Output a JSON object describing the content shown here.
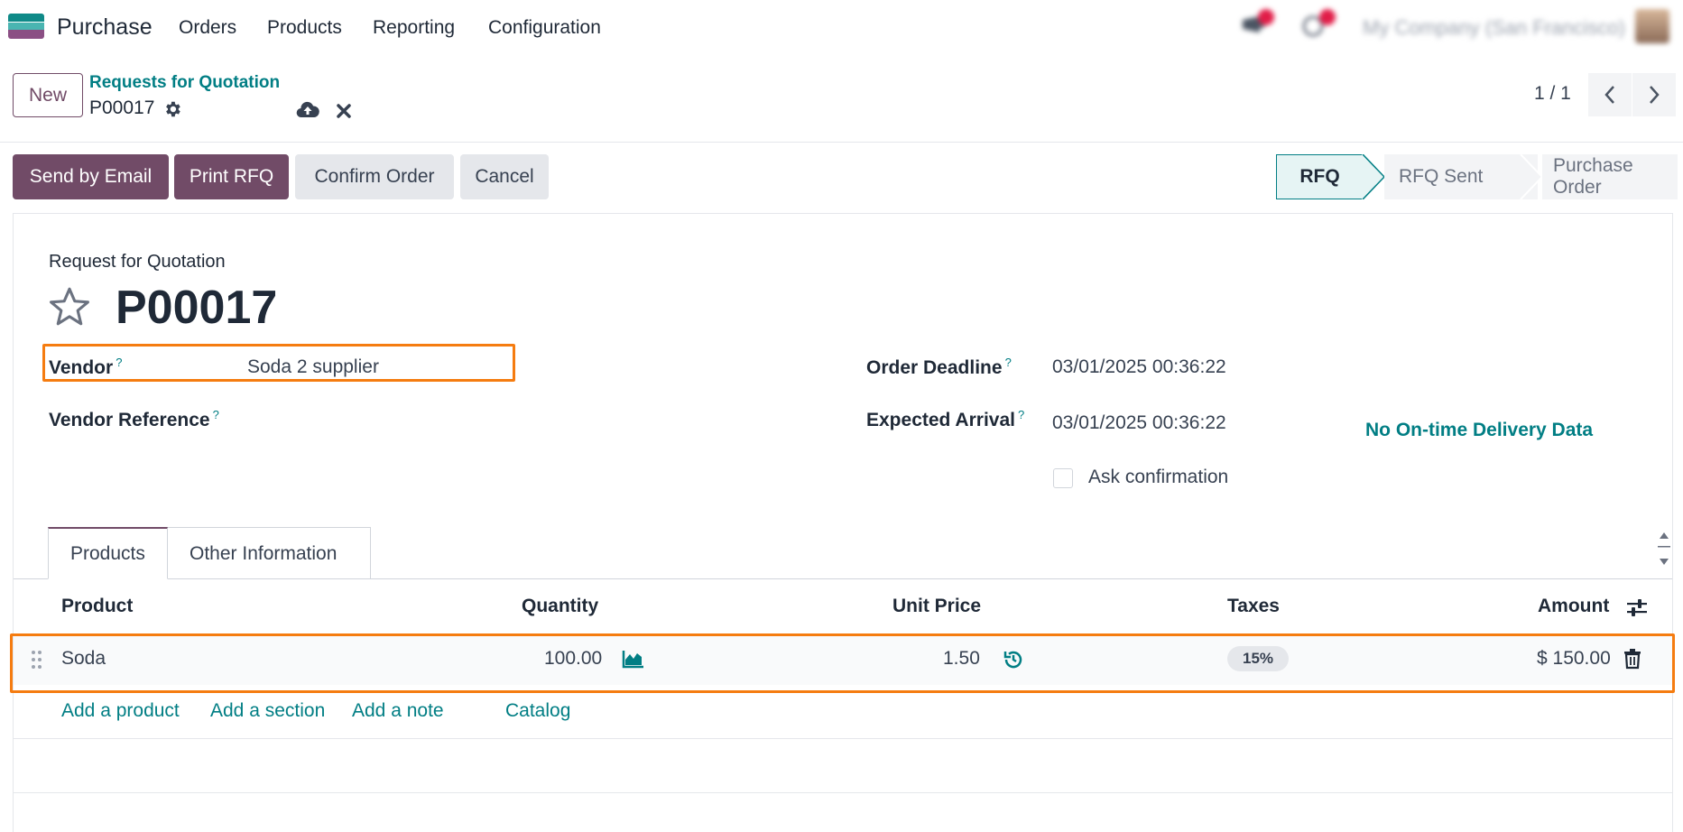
{
  "topnav": {
    "app_name": "Purchase",
    "menu": [
      "Orders",
      "Products",
      "Reporting",
      "Configuration"
    ],
    "company": "My Company (San Francisco)"
  },
  "control_panel": {
    "new_label": "New",
    "breadcrumb": "Requests for Quotation",
    "record_name": "P00017",
    "pager": "1 / 1"
  },
  "actions": {
    "send_email": "Send by Email",
    "print_rfq": "Print RFQ",
    "confirm": "Confirm Order",
    "cancel": "Cancel"
  },
  "status_bar": {
    "stages": [
      "RFQ",
      "RFQ Sent",
      "Purchase Order"
    ],
    "current": "RFQ"
  },
  "form": {
    "doc_type": "Request for Quotation",
    "title": "P00017",
    "vendor_label": "Vendor",
    "vendor_value": "Soda 2 supplier",
    "vendor_ref_label": "Vendor Reference",
    "order_deadline_label": "Order Deadline",
    "order_deadline_value": "03/01/2025 00:36:22",
    "expected_arrival_label": "Expected Arrival",
    "expected_arrival_value": "03/01/2025 00:36:22",
    "ontime": "No On-time Delivery Data",
    "ask_confirmation": "Ask confirmation",
    "help_mark": "?"
  },
  "tabs": [
    "Products",
    "Other Information"
  ],
  "table": {
    "columns": [
      "Product",
      "Quantity",
      "Unit Price",
      "Taxes",
      "Amount"
    ],
    "rows": [
      {
        "product": "Soda",
        "quantity": "100.00",
        "unit_price": "1.50",
        "taxes": "15%",
        "amount": "$ 150.00"
      }
    ],
    "add_links": [
      "Add a product",
      "Add a section",
      "Add a note",
      "Catalog"
    ]
  },
  "colors": {
    "primary": "#714b67",
    "link": "#017e84",
    "highlight": "#f57c10"
  }
}
